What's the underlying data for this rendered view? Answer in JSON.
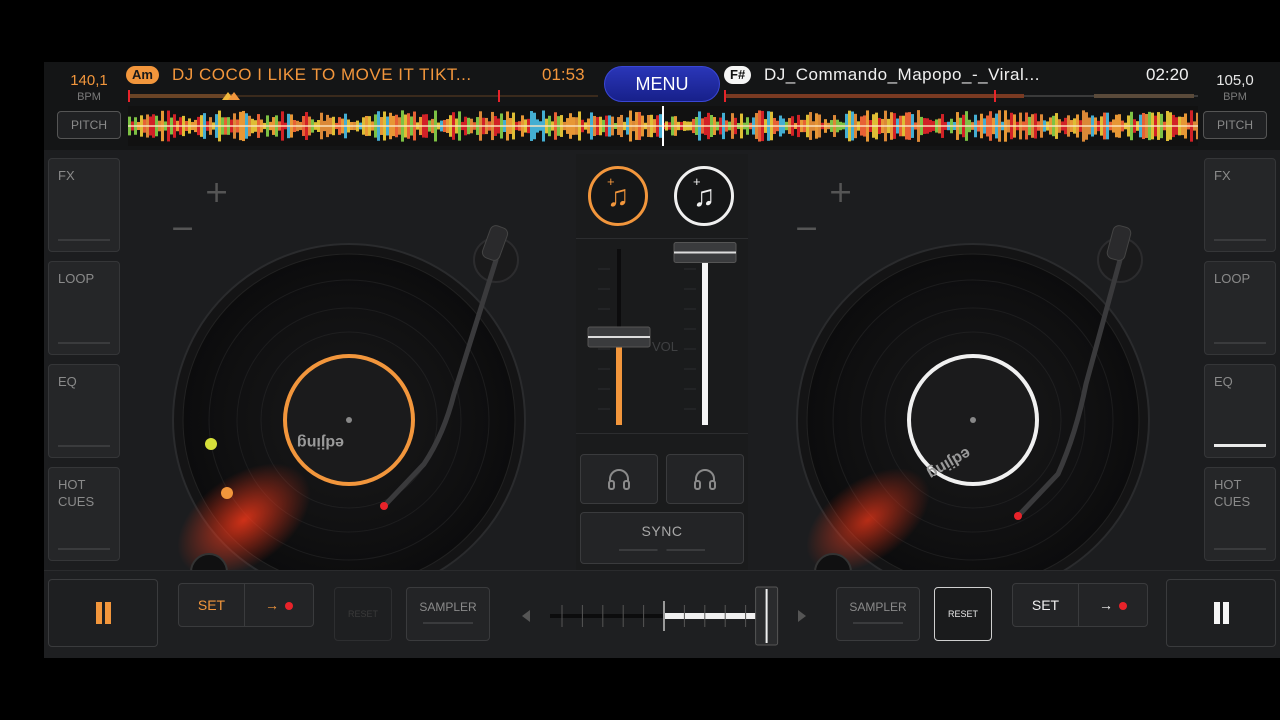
{
  "deck_a": {
    "bpm": "140,1",
    "bpm_unit": "BPM",
    "pitch_label": "PITCH",
    "key": "Am",
    "title": "DJ COCO I LIKE TO MOVE IT TIKT...",
    "time": "01:53",
    "accent": "#f2963c",
    "set_label": "SET",
    "arrow": "→",
    "reset_label": "RESET",
    "sampler_label": "SAMPLER"
  },
  "deck_b": {
    "bpm": "105,0",
    "bpm_unit": "BPM",
    "pitch_label": "PITCH",
    "key": "F#",
    "title": "DJ_Commando_Mapopo_-_Viral...",
    "time": "02:20",
    "accent": "#f5f5f5",
    "set_label": "SET",
    "arrow": "→",
    "reset_label": "RESET",
    "sampler_label": "SAMPLER"
  },
  "menu_label": "MENU",
  "side_buttons_left": [
    "FX",
    "LOOP",
    "EQ",
    "HOT\nCUES"
  ],
  "side_buttons_right": [
    "FX",
    "LOOP",
    "EQ",
    "HOT\nCUES"
  ],
  "mixer": {
    "vol_label": "VOL",
    "sync_label": "SYNC",
    "deck_a_volume": 0.5,
    "deck_b_volume": 0.98,
    "crossfader_position": 0.95,
    "deck_a_icon": "music-note-plus-icon",
    "deck_b_icon": "music-note-plus-icon",
    "headphone_icon": "headphones-icon"
  },
  "platter_label": "edjing",
  "colors": {
    "deck_a_accent": "#f2963c",
    "deck_b_accent": "#f5f5f5",
    "menu_blue": "#1e2aa8",
    "cue_red": "#e8232a"
  }
}
